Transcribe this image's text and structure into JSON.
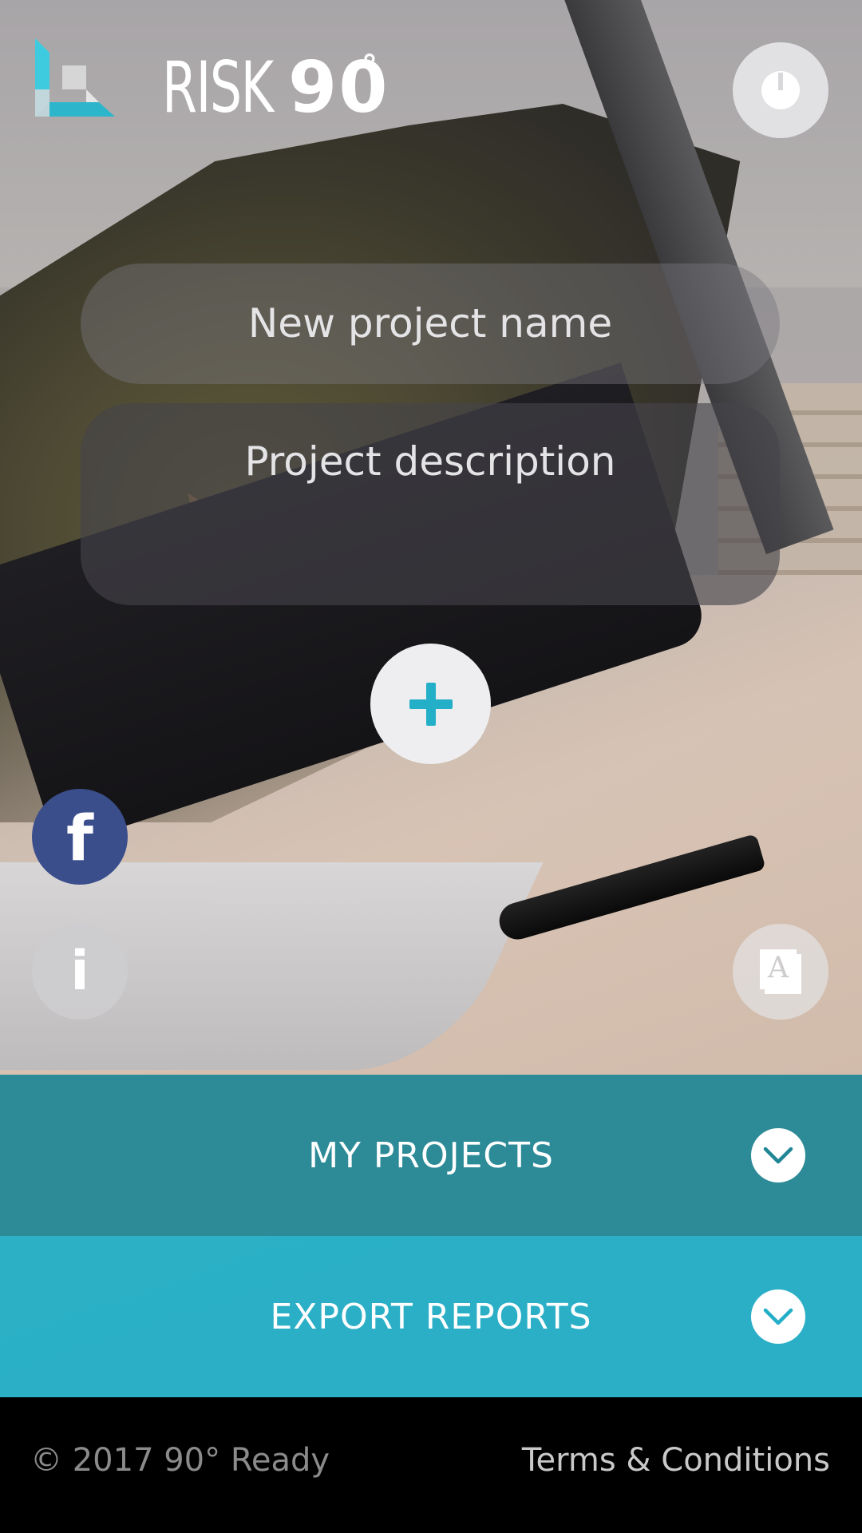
{
  "header": {
    "logo_word": "RISK",
    "logo_number": "90",
    "logo_degree": "°",
    "logo_icon": "risk90-logo-icon",
    "power_icon": "power-icon"
  },
  "form": {
    "name_placeholder": "New project name",
    "description_placeholder": "Project description",
    "add_icon": "plus-icon"
  },
  "side_actions": {
    "facebook_label": "f",
    "info_label": "i",
    "dictionary_label": "A",
    "facebook_icon": "facebook-icon",
    "info_icon": "info-icon",
    "dictionary_icon": "dictionary-icon"
  },
  "sections": [
    {
      "label": "MY PROJECTS",
      "icon": "chevron-down-icon"
    },
    {
      "label": "EXPORT REPORTS",
      "icon": "chevron-down-icon"
    }
  ],
  "footer": {
    "copyright": "©  2017 90° Ready",
    "terms": "Terms & Conditions"
  },
  "colors": {
    "accent_teal": "#23AFC7",
    "dark_teal": "#208696",
    "facebook_blue": "#3B4E8C",
    "logo_cyan": "#3ECBE0",
    "footer_bg": "#000000"
  }
}
